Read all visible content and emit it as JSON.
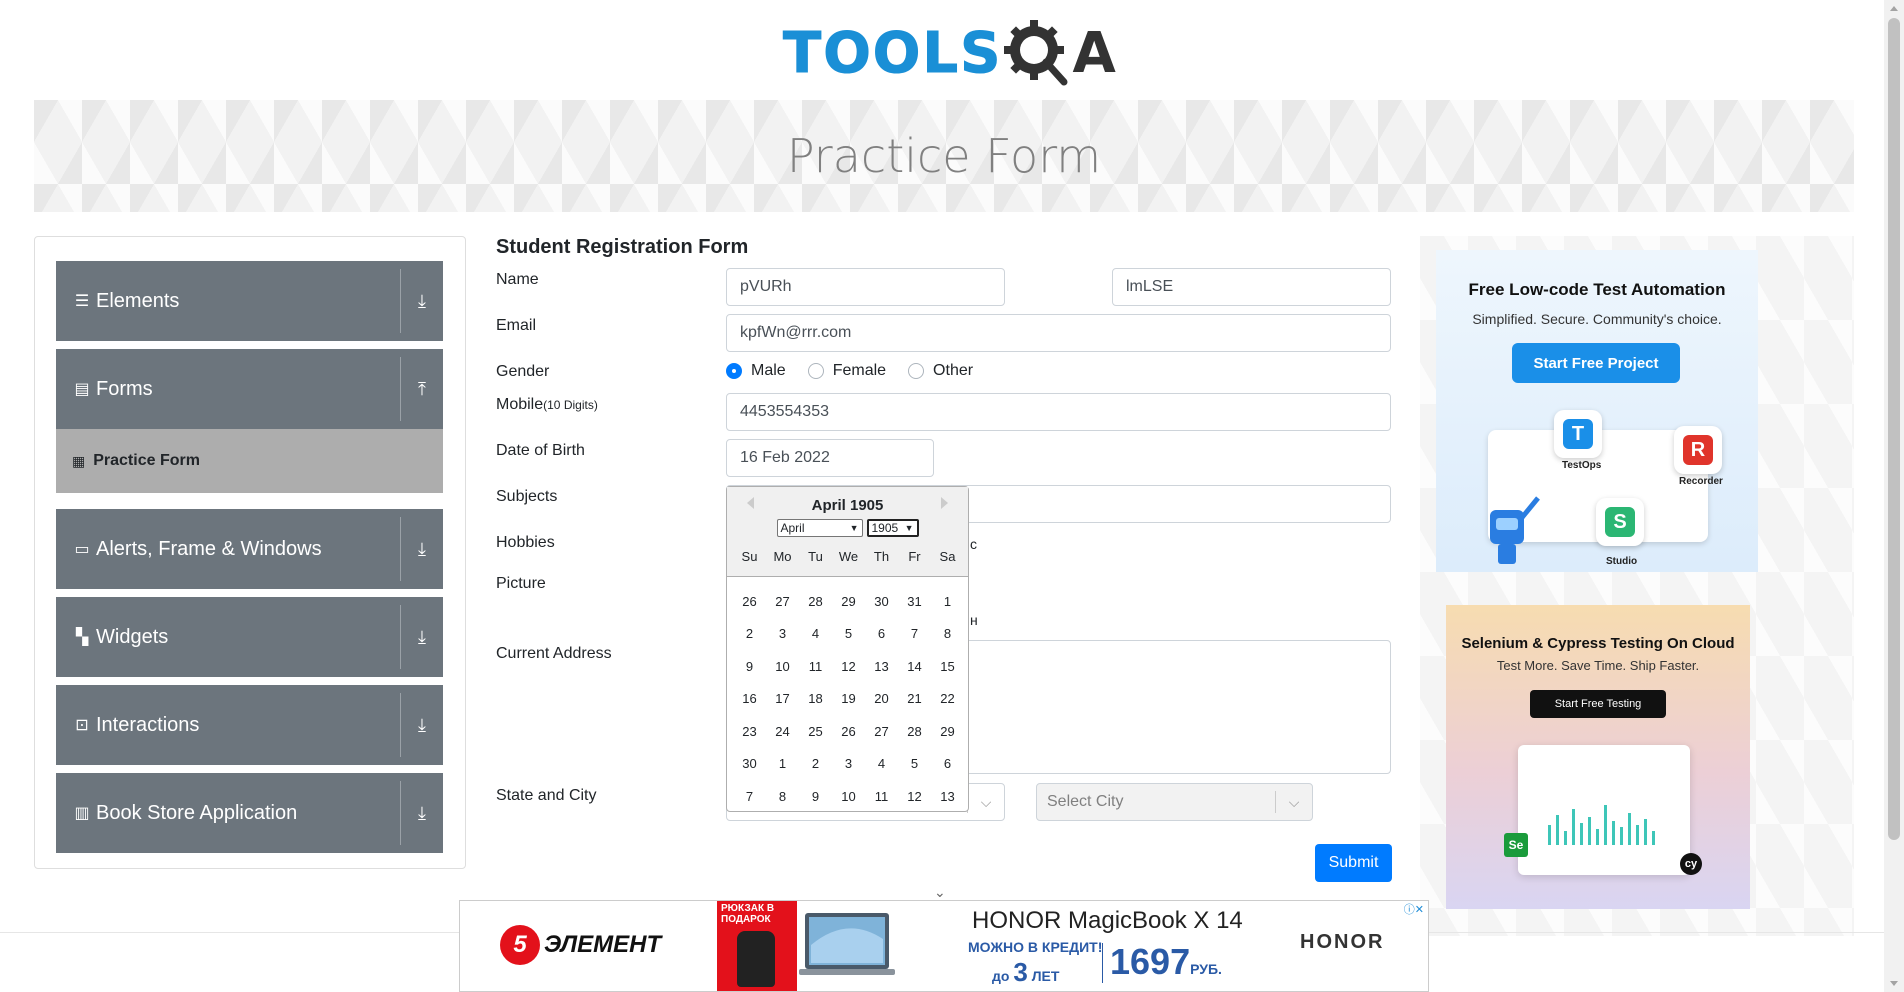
{
  "header": {
    "logo_text": "TOOLS",
    "logo_suffix": "A",
    "page_title": "Practice Form"
  },
  "sidebar": {
    "groups": [
      {
        "label": "Elements",
        "icon": "hamburger-icon",
        "arrow": "download-icon"
      },
      {
        "label": "Forms",
        "icon": "document-icon",
        "arrow": "upload-icon"
      },
      {
        "label": "Alerts, Frame & Windows",
        "icon": "window-icon",
        "arrow": "download-icon"
      },
      {
        "label": "Widgets",
        "icon": "grid-icon",
        "arrow": "download-icon"
      },
      {
        "label": "Interactions",
        "icon": "interaction-icon",
        "arrow": "download-icon"
      },
      {
        "label": "Book Store Application",
        "icon": "books-icon",
        "arrow": "download-icon"
      }
    ],
    "active_item": "Practice Form"
  },
  "form": {
    "title": "Student Registration Form",
    "name_label": "Name",
    "first_name": "pVURh",
    "last_name": "lmLSE",
    "email_label": "Email",
    "email": "kpfWn@rrr.com",
    "gender_label": "Gender",
    "gender_options": [
      "Male",
      "Female",
      "Other"
    ],
    "gender_selected": "Male",
    "mobile_label": "Mobile",
    "mobile_hint": "(10 Digits)",
    "mobile": "4453554353",
    "dob_label": "Date of Birth",
    "dob": "16 Feb 2022",
    "subjects_label": "Subjects",
    "hobbies_label": "Hobbies",
    "hobbies_partial": "c",
    "picture_label": "Picture",
    "picture_partial": "н",
    "address_label": "Current Address",
    "state_city_label": "State and City",
    "city_placeholder": "Select City",
    "submit_label": "Submit"
  },
  "calendar": {
    "month_year": "April 1905",
    "month_select": "April",
    "year_select": "1905",
    "weekdays": [
      "Su",
      "Mo",
      "Tu",
      "We",
      "Th",
      "Fr",
      "Sa"
    ],
    "weeks": [
      [
        "26",
        "27",
        "28",
        "29",
        "30",
        "31",
        "1"
      ],
      [
        "2",
        "3",
        "4",
        "5",
        "6",
        "7",
        "8"
      ],
      [
        "9",
        "10",
        "11",
        "12",
        "13",
        "14",
        "15"
      ],
      [
        "16",
        "17",
        "18",
        "19",
        "20",
        "21",
        "22"
      ],
      [
        "23",
        "24",
        "25",
        "26",
        "27",
        "28",
        "29"
      ],
      [
        "30",
        "1",
        "2",
        "3",
        "4",
        "5",
        "6"
      ],
      [
        "7",
        "8",
        "9",
        "10",
        "11",
        "12",
        "13"
      ]
    ]
  },
  "ads": {
    "ad1": {
      "title": "Free Low-code Test Automation",
      "subtitle": "Simplified. Secure. Community's choice.",
      "button": "Start Free Project",
      "labels": [
        "TestOps",
        "Recorder",
        "Studio"
      ]
    },
    "ad2": {
      "title": "Selenium & Cypress Testing On Cloud",
      "subtitle": "Test More. Save Time. Ship Faster.",
      "button": "Start Free Testing",
      "badge_se": "Se",
      "badge_cy": "cy"
    },
    "bottom": {
      "brand_num": "5",
      "brand": "ЭЛЕМЕНТ",
      "promo": "РЮКЗАК В ПОДАРОК",
      "title": "HONOR MagicBook X 14",
      "credit": "МОЖНО В КРЕДИТ!",
      "term_prefix": "до",
      "term_num": "3",
      "term_suffix": "ЛЕТ",
      "price": "1697",
      "currency": "РУБ.",
      "honor": "HONOR"
    }
  },
  "colors": {
    "sidebar_group": "#6c757d",
    "sidebar_active": "#adadad",
    "primary": "#007bff",
    "logo_blue": "#1a8fd6"
  }
}
